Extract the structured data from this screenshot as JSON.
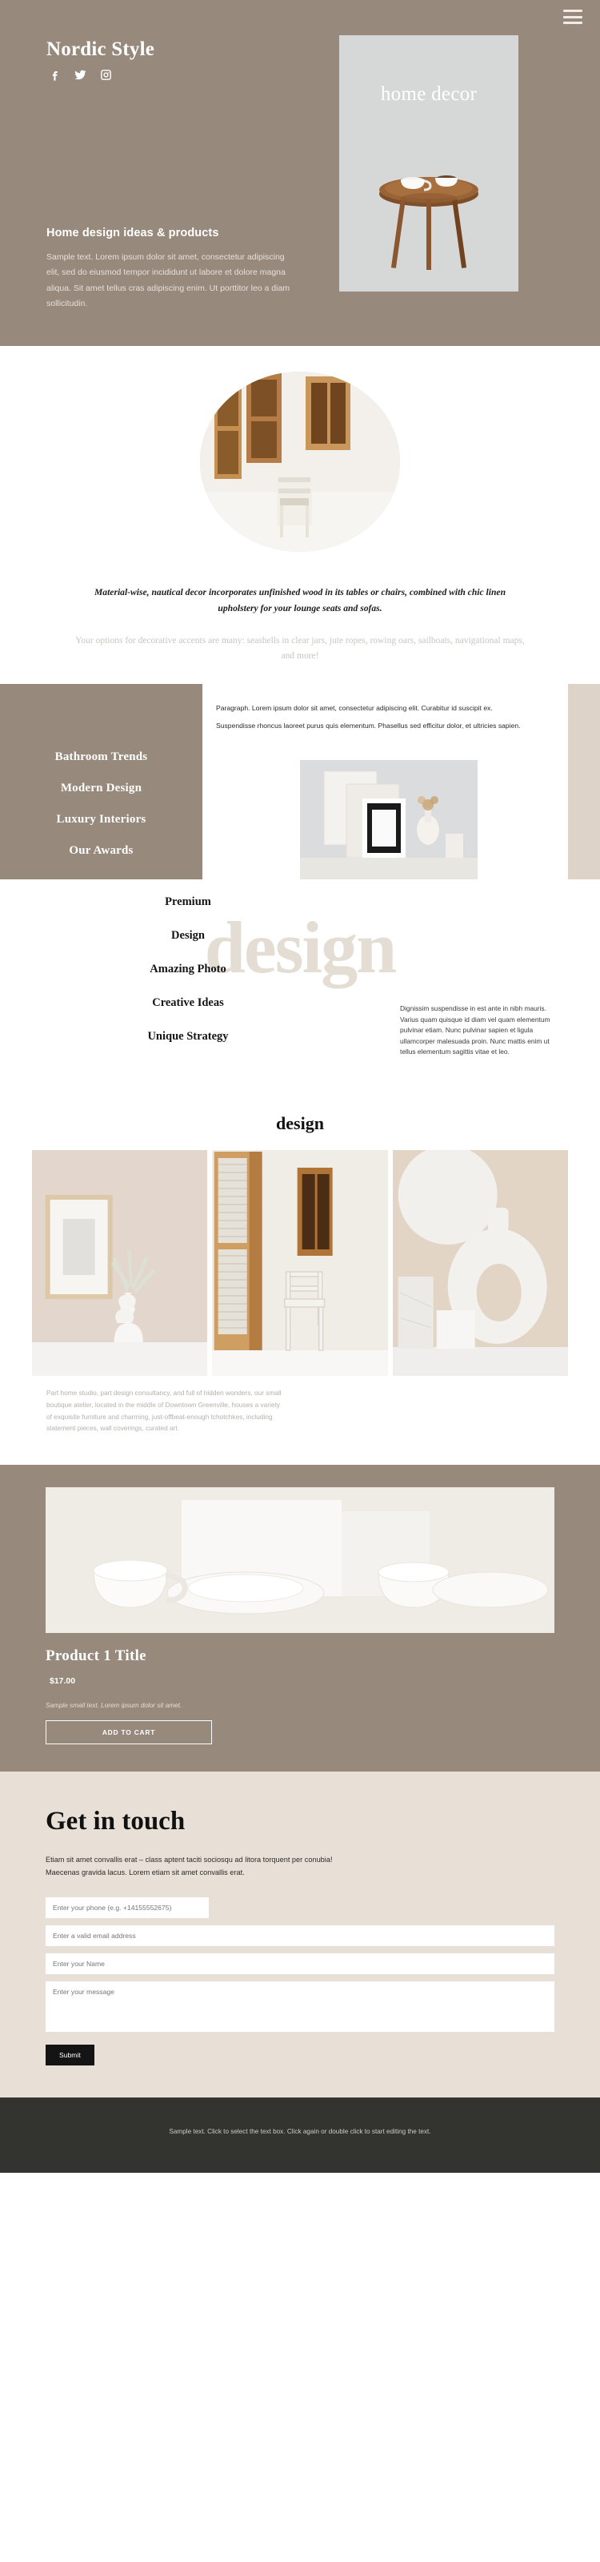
{
  "hero": {
    "brand": "Nordic Style",
    "socials": [
      {
        "name": "facebook-icon",
        "label": "Facebook"
      },
      {
        "name": "twitter-icon",
        "label": "Twitter"
      },
      {
        "name": "instagram-icon",
        "label": "Instagram"
      }
    ],
    "menu_icon": "hamburger-menu-icon",
    "heading": "Home design ideas & products",
    "paragraph": "Sample text. Lorem ipsum dolor sit amet, consectetur adipiscing elit, sed do eiusmod tempor incididunt ut labore et dolore magna aliqua. Sit amet tellus cras adipiscing enim. Ut porttitor leo a diam sollicitudin.",
    "card_label": "home decor",
    "bg_color": "#97897c"
  },
  "intro": {
    "quote": "Material-wise, nautical decor incorporates unfinished wood in its tables or chairs, combined with chic linen upholstery for your lounge seats and sofas.",
    "subquote": "Your options for decorative accents are many: seashells in clear jars, jute ropes, rowing oars, sailboats, navigational maps, and more!",
    "chevron": "»"
  },
  "trends": {
    "menu": [
      {
        "label": "Bathroom Trends"
      },
      {
        "label": "Modern Design"
      },
      {
        "label": "Luxury Interiors"
      },
      {
        "label": "Our Awards"
      }
    ],
    "paragraphs": [
      "Paragraph. Lorem ipsum dolor sit amet, consectetur adipiscing elit. Curabitur id suscipit ex.",
      "Suspendisse rhoncus laoreet purus quis elementum. Phasellus sed efficitur dolor, et ultricies sapien."
    ],
    "panel_color": "#97897c",
    "accent_color": "#ddd3c8"
  },
  "design": {
    "watermark": "design",
    "items": [
      {
        "label": "Premium"
      },
      {
        "label": "Design"
      },
      {
        "label": "Amazing Photo"
      },
      {
        "label": "Creative Ideas"
      },
      {
        "label": "Unique Strategy"
      }
    ],
    "paragraph": "Dignissim suspendisse in est ante in nibh mauris. Varius quam quisque id diam vel quam elementum pulvinar etiam. Nunc pulvinar sapien et ligula ullamcorper malesuada proin. Nunc mattis enim ut tellus elementum sagittis vitae et leo.",
    "watermark_color": "#e4ddd4"
  },
  "gallery": {
    "title": "design",
    "note": "Part home studio, part design consultancy, and full of hidden wonders, our small boutique atelier, located in the middle of Downtown Greenville, houses a variety of exquisite furniture and charming, just-offbeat-enough tchotchkes, including statement pieces, wall coverings, curated art.",
    "images": [
      {
        "alt": "framed-picture-and-vase"
      },
      {
        "alt": "wooden-shutters-and-chair"
      },
      {
        "alt": "ceramic-donut-vase"
      }
    ]
  },
  "product": {
    "title": "Product 1 Title",
    "price": "$17.00",
    "small_text": "Sample small text. Lorem ipsum dolor sit amet.",
    "button_label": "ADD TO CART",
    "bg_color": "#97897c"
  },
  "contact": {
    "heading": "Get in touch",
    "lead": "Etiam sit amet convallis erat – class aptent taciti sociosqu ad litora torquent per conubia! Maecenas gravida lacus. Lorem etiam sit amet convallis erat.",
    "fields": [
      {
        "name": "phone",
        "placeholder": "Enter your phone (e.g. +14155552675)",
        "value": ""
      },
      {
        "name": "email",
        "placeholder": "Enter a valid email address",
        "value": ""
      },
      {
        "name": "name",
        "placeholder": "Enter your Name",
        "value": ""
      }
    ],
    "message_placeholder": "Enter your message",
    "message_value": "",
    "submit_label": "Submit",
    "bg_color": "#e8dfd6"
  },
  "footer": {
    "text": "Sample text. Click to select the text box. Click again or double click to start editing the text.",
    "bg_color": "#333330"
  }
}
